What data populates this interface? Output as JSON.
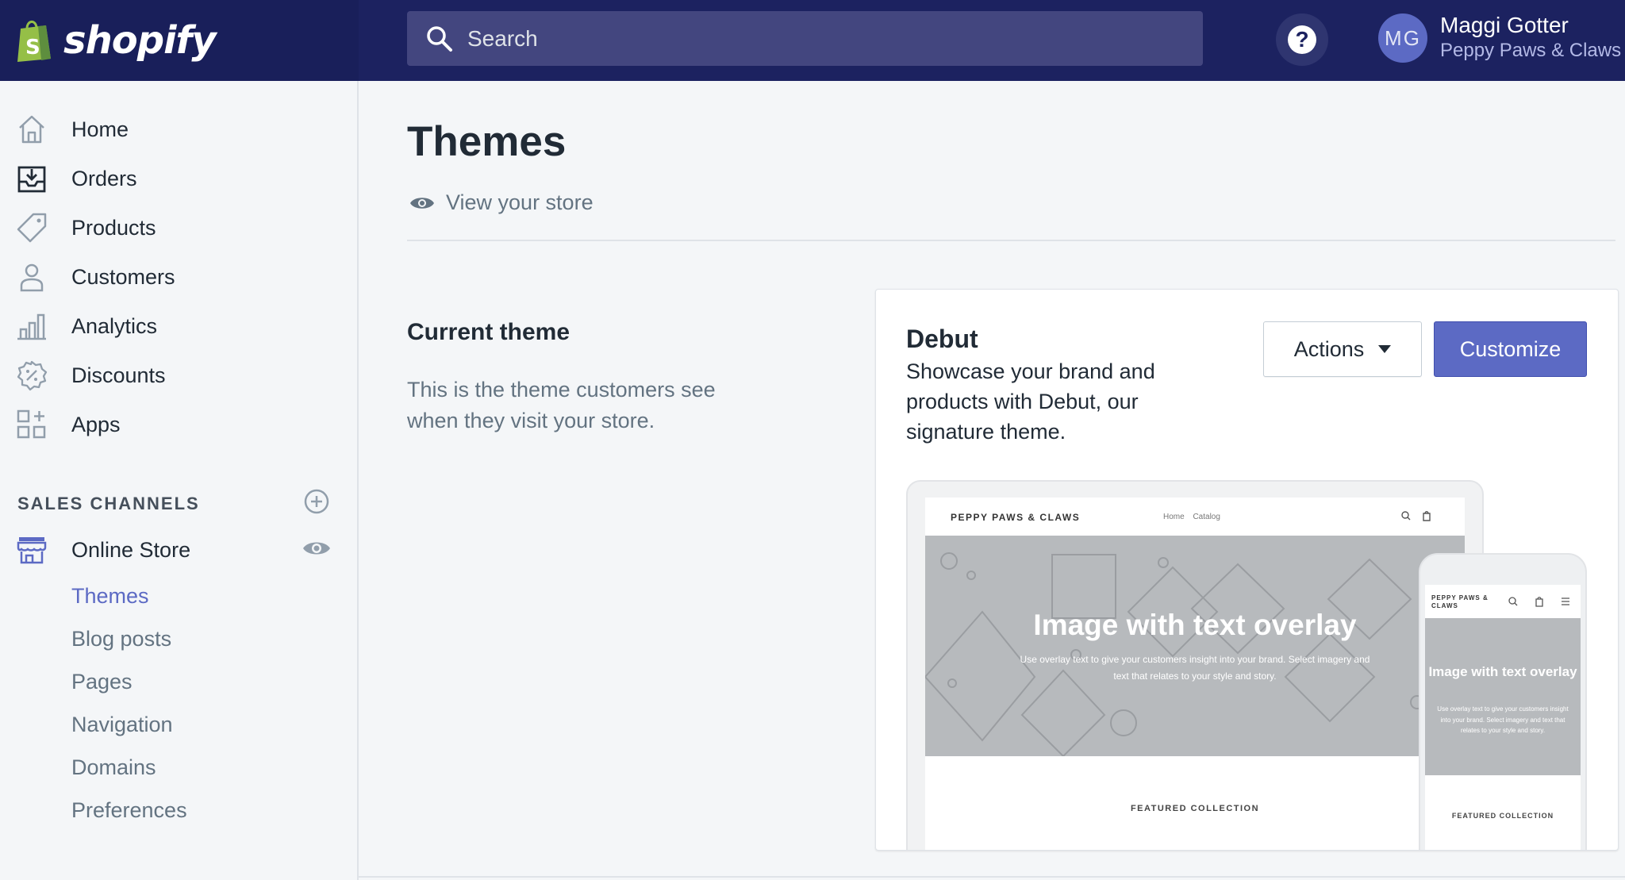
{
  "topbar": {
    "brand": "shopify",
    "search_placeholder": "Search",
    "help_label": "?",
    "user_initials": "MG",
    "user_name": "Maggi Gotter",
    "store_name": "Peppy Paws & Claws"
  },
  "sidebar": {
    "items": [
      {
        "label": "Home",
        "icon": "home-icon"
      },
      {
        "label": "Orders",
        "icon": "orders-icon"
      },
      {
        "label": "Products",
        "icon": "tag-icon"
      },
      {
        "label": "Customers",
        "icon": "person-icon"
      },
      {
        "label": "Analytics",
        "icon": "bar-chart-icon"
      },
      {
        "label": "Discounts",
        "icon": "discount-icon"
      },
      {
        "label": "Apps",
        "icon": "apps-icon"
      }
    ],
    "sales_channels_title": "SALES CHANNELS",
    "online_store": "Online Store",
    "sub_items": [
      "Themes",
      "Blog posts",
      "Pages",
      "Navigation",
      "Domains",
      "Preferences"
    ],
    "active_sub_item": "Themes"
  },
  "main": {
    "title": "Themes",
    "view_store": "View your store",
    "current_theme_title": "Current theme",
    "current_theme_desc": "This is the theme customers see when they visit your store."
  },
  "theme_card": {
    "name": "Debut",
    "description": "Showcase your brand and products with Debut, our signature theme.",
    "actions_label": "Actions",
    "customize_label": "Customize"
  },
  "preview": {
    "store_name": "PEPPY PAWS & CLAWS",
    "nav_links": "Home Catalog",
    "hero_title": "Image with text overlay",
    "hero_text": "Use overlay text to give your customers insight into your brand. Select imagery and text that relates to your style and story.",
    "featured": "FEATURED COLLECTION"
  },
  "colors": {
    "topbar": "#1c2260",
    "accent": "#5c6ac4",
    "sidebar_bg": "#f4f6f8"
  }
}
